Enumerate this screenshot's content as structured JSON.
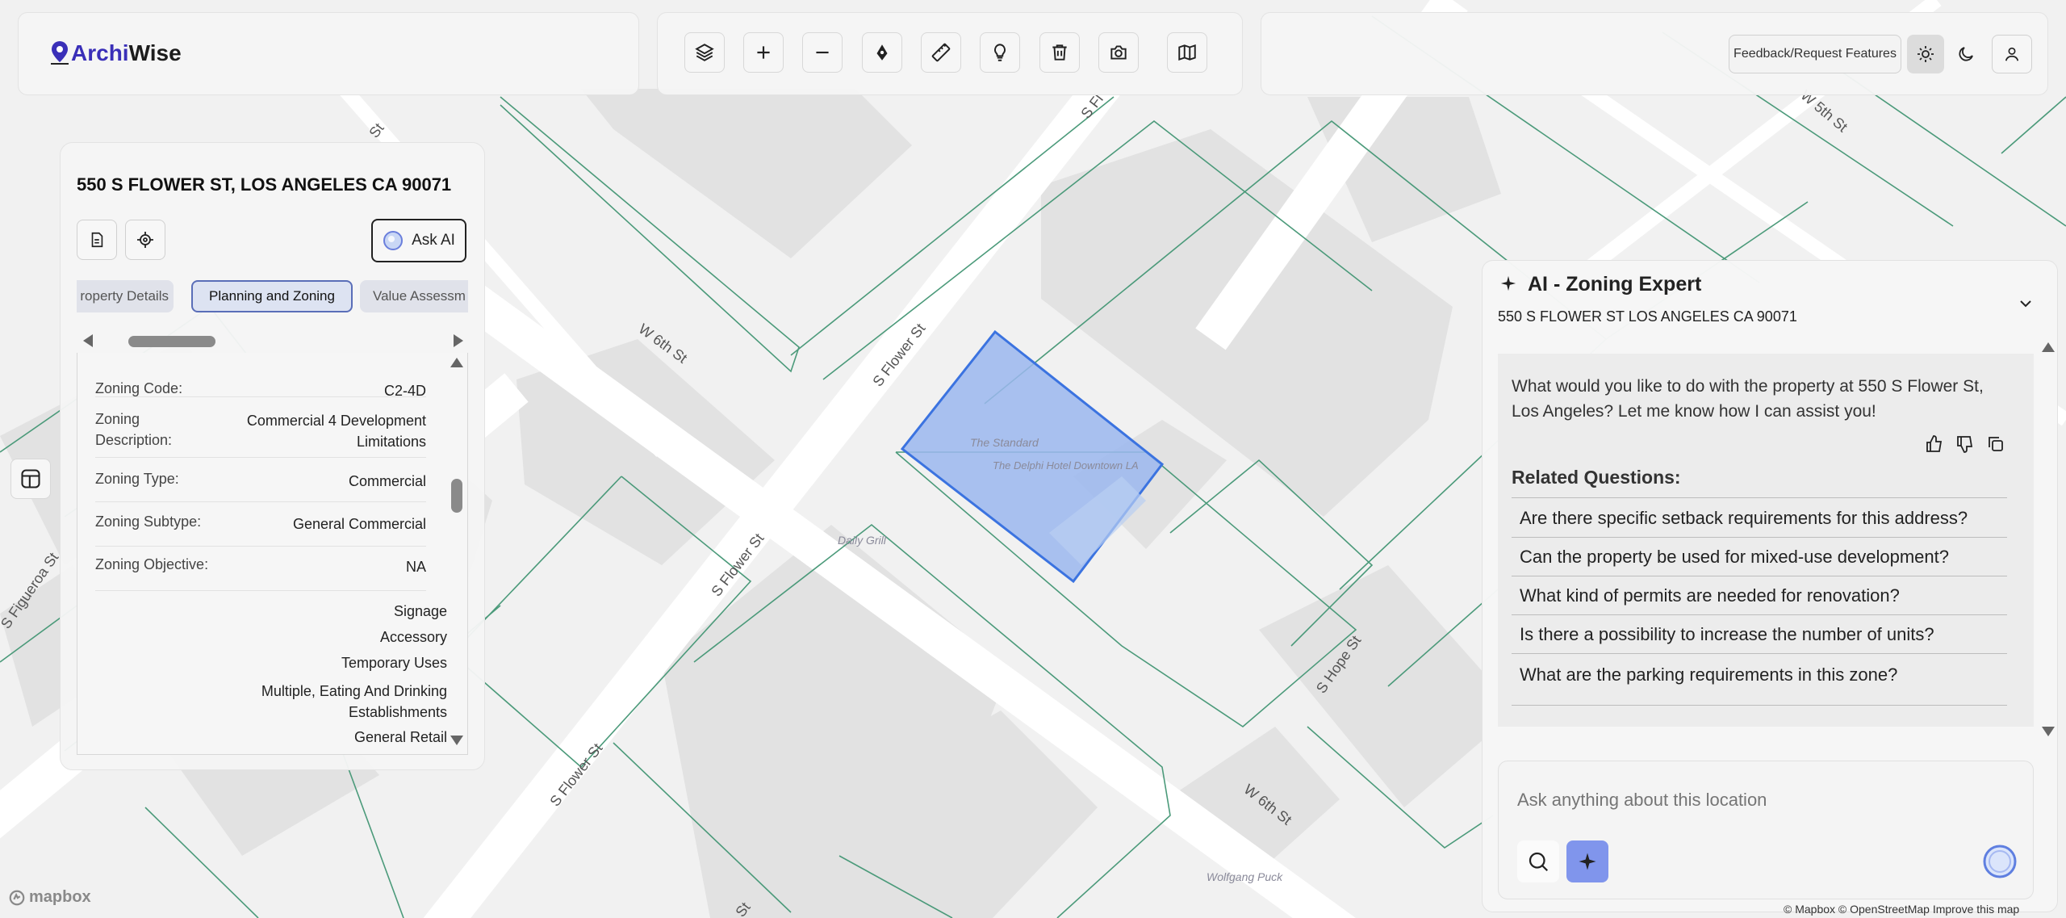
{
  "app": {
    "logo_prefix": "Archi",
    "logo_suffix": "Wise"
  },
  "toolbar": {
    "buttons": [
      "layers-icon",
      "zoom-in-icon",
      "zoom-out-icon",
      "pen-icon",
      "ruler-icon",
      "lightbulb-icon",
      "trash-icon",
      "camera-icon",
      "map-icon"
    ]
  },
  "header_right": {
    "feedback_label": "Feedback/Request Features",
    "theme_active": "light"
  },
  "property_panel": {
    "address": "550 S FLOWER ST, LOS ANGELES CA 90071",
    "ask_ai_label": "Ask AI",
    "tabs": [
      {
        "label": "roperty Details",
        "active": false
      },
      {
        "label": "Planning and Zoning",
        "active": true
      },
      {
        "label": "Value Assessm",
        "active": false
      }
    ],
    "fields": [
      {
        "label": "Zoning Code:",
        "value": "C2-4D"
      },
      {
        "label": "Zoning Description:",
        "value": "Commercial 4 Development Limitations"
      },
      {
        "label": "Zoning Type:",
        "value": "Commercial"
      },
      {
        "label": "Zoning Subtype:",
        "value": "General Commercial"
      },
      {
        "label": "Zoning Objective:",
        "value": "NA"
      }
    ],
    "permitted_uses": [
      "Signage",
      "Accessory",
      "Temporary Uses",
      "Multiple, Eating And Drinking Establishments",
      "General Retail"
    ]
  },
  "map": {
    "street_labels": [
      "W 6th St",
      "S Flower St",
      "S Flower St",
      "S Flower St",
      "S Hope St",
      "W 6th St",
      "S Figueroa St",
      "W 5th St",
      "S Fl",
      "St",
      "St"
    ],
    "poi_labels": [
      "The Standard",
      "The Delphi Hotel Downtown LA",
      "Daily Grill",
      "Wolfgang Puck"
    ],
    "attribution_logo": "mapbox",
    "attribution_text": "© Mapbox © OpenStreetMap  Improve this map"
  },
  "chat": {
    "title": "AI - Zoning Expert",
    "address": "550 S FLOWER ST LOS ANGELES CA 90071",
    "message": "What would you like to do with the property at 550 S Flower St, Los Angeles? Let me know how I can assist you!",
    "related_heading": "Related Questions:",
    "related_questions": [
      "Are there specific setback requirements for this address?",
      "Can the property be used for mixed-use development?",
      "What kind of permits are needed for renovation?",
      "Is there a possibility to increase the number of units?",
      "What are the parking requirements in this zone?"
    ],
    "input_placeholder": "Ask anything about this location"
  }
}
